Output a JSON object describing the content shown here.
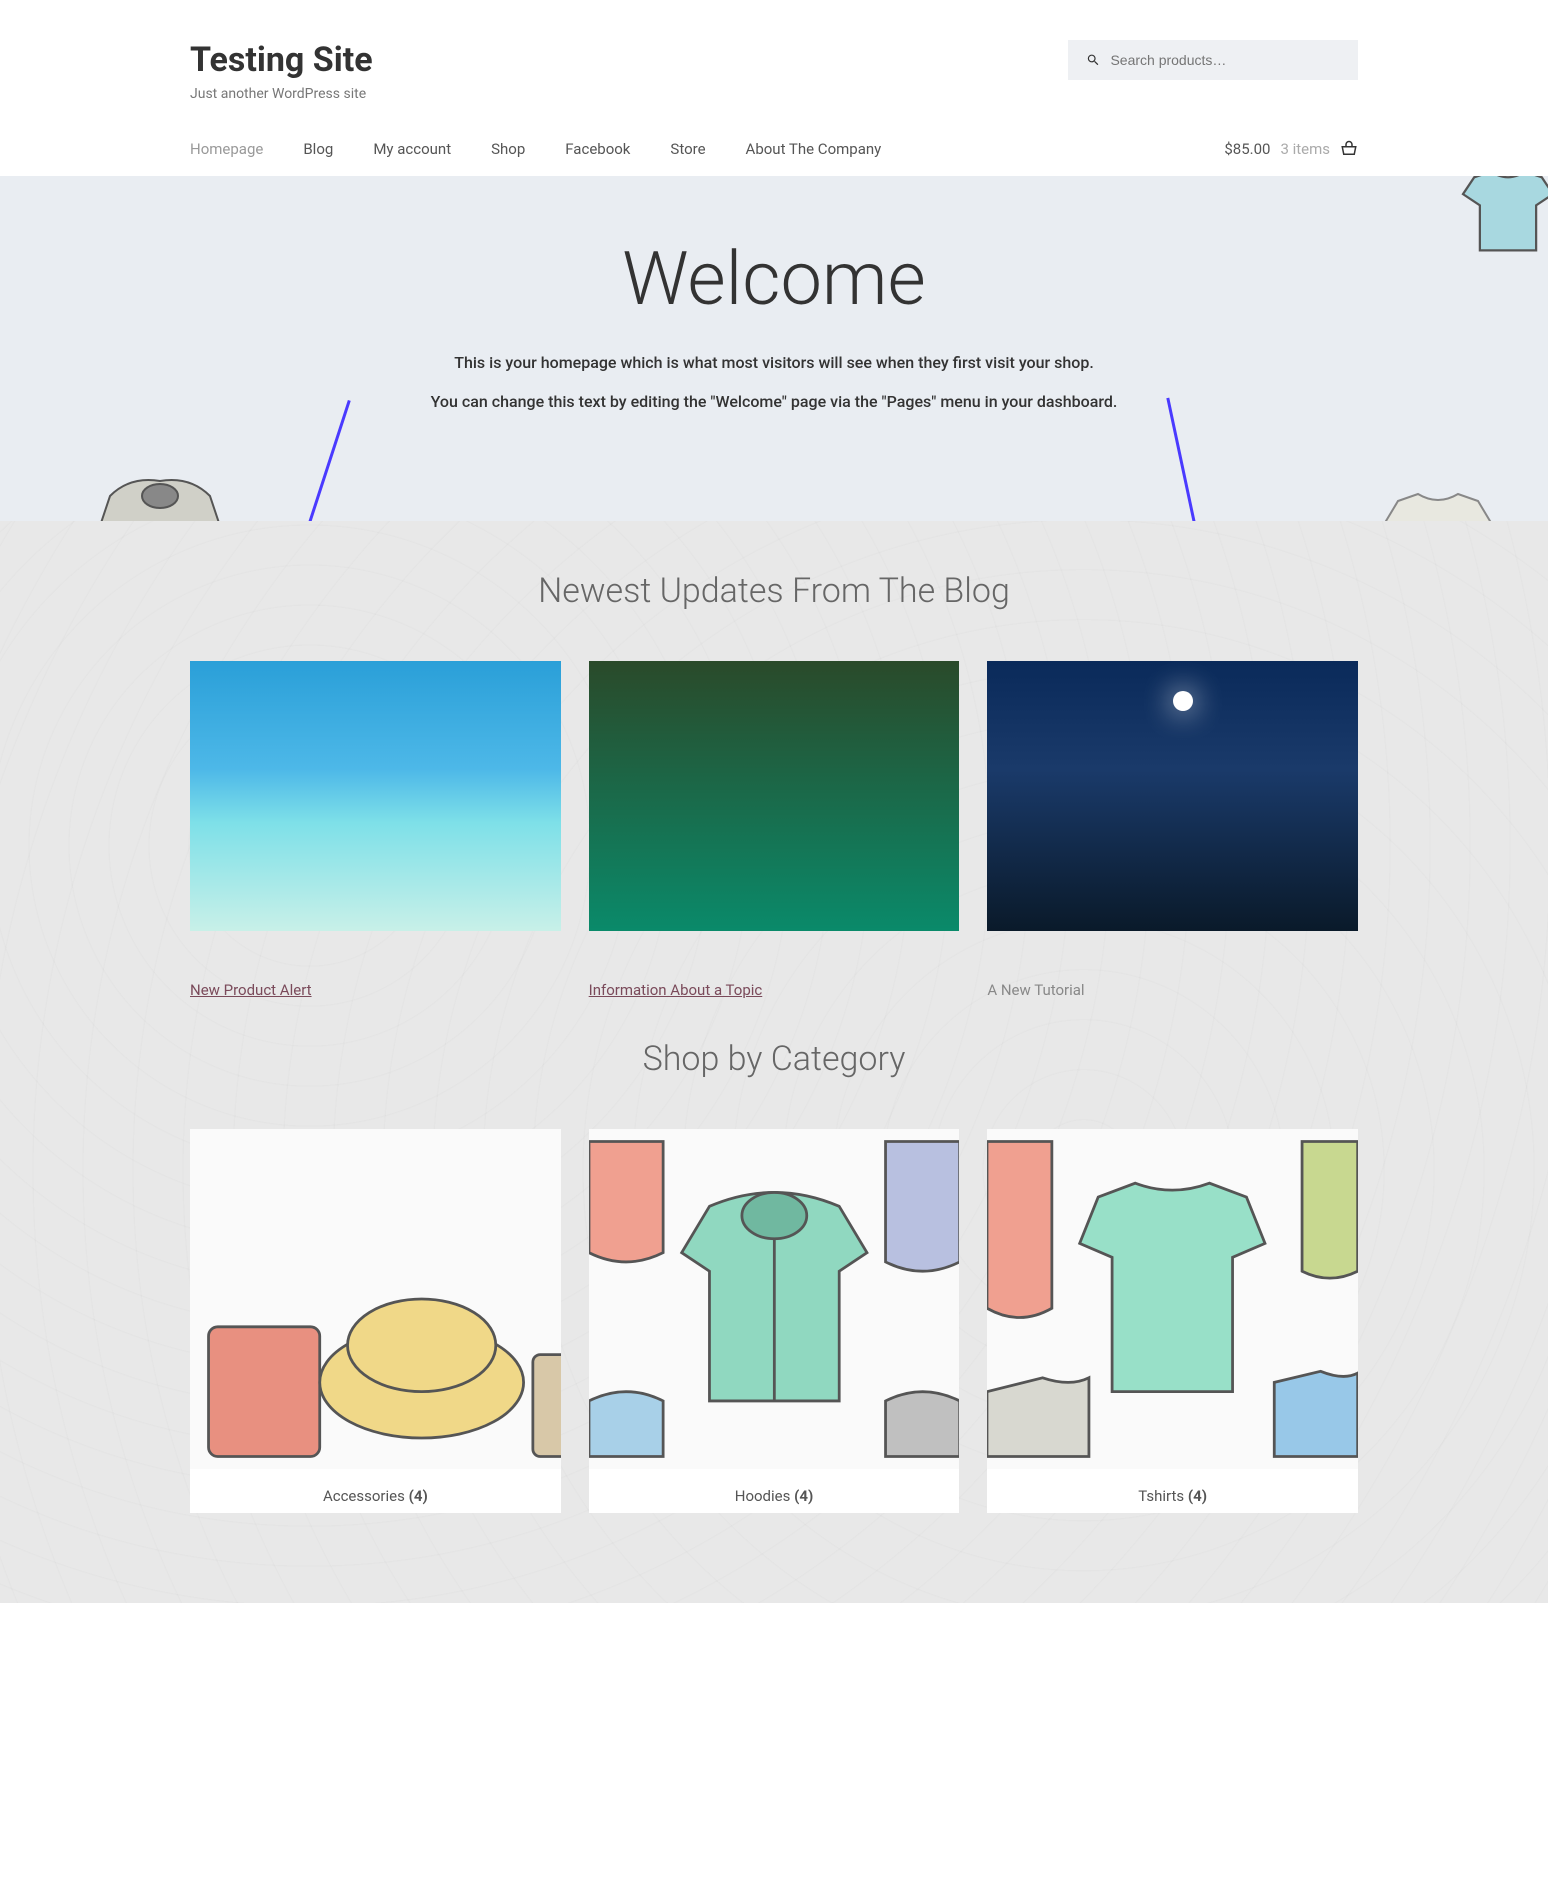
{
  "site": {
    "title": "Testing Site",
    "tagline": "Just another WordPress site"
  },
  "search": {
    "placeholder": "Search products…"
  },
  "nav": [
    {
      "label": "Homepage",
      "active": true
    },
    {
      "label": "Blog"
    },
    {
      "label": "My account"
    },
    {
      "label": "Shop"
    },
    {
      "label": "Facebook"
    },
    {
      "label": "Store"
    },
    {
      "label": "About The Company"
    }
  ],
  "cart": {
    "total": "$85.00",
    "items": "3 items"
  },
  "hero": {
    "title": "Welcome",
    "line1": "This is your homepage which is what most visitors will see when they first visit your shop.",
    "line2": "You can change this text by editing the \"Welcome\" page via the \"Pages\" menu in your dashboard."
  },
  "blog": {
    "heading": "Newest Updates From The Blog",
    "posts": [
      {
        "title": "New Product Alert",
        "underline": true
      },
      {
        "title": "Information About a Topic",
        "underline": true
      },
      {
        "title": "A New Tutorial",
        "underline": false
      }
    ]
  },
  "categories": {
    "heading": "Shop by Category",
    "items": [
      {
        "name": "Accessories",
        "count": "(4)"
      },
      {
        "name": "Hoodies",
        "count": "(4)"
      },
      {
        "name": "Tshirts",
        "count": "(4)"
      }
    ]
  }
}
